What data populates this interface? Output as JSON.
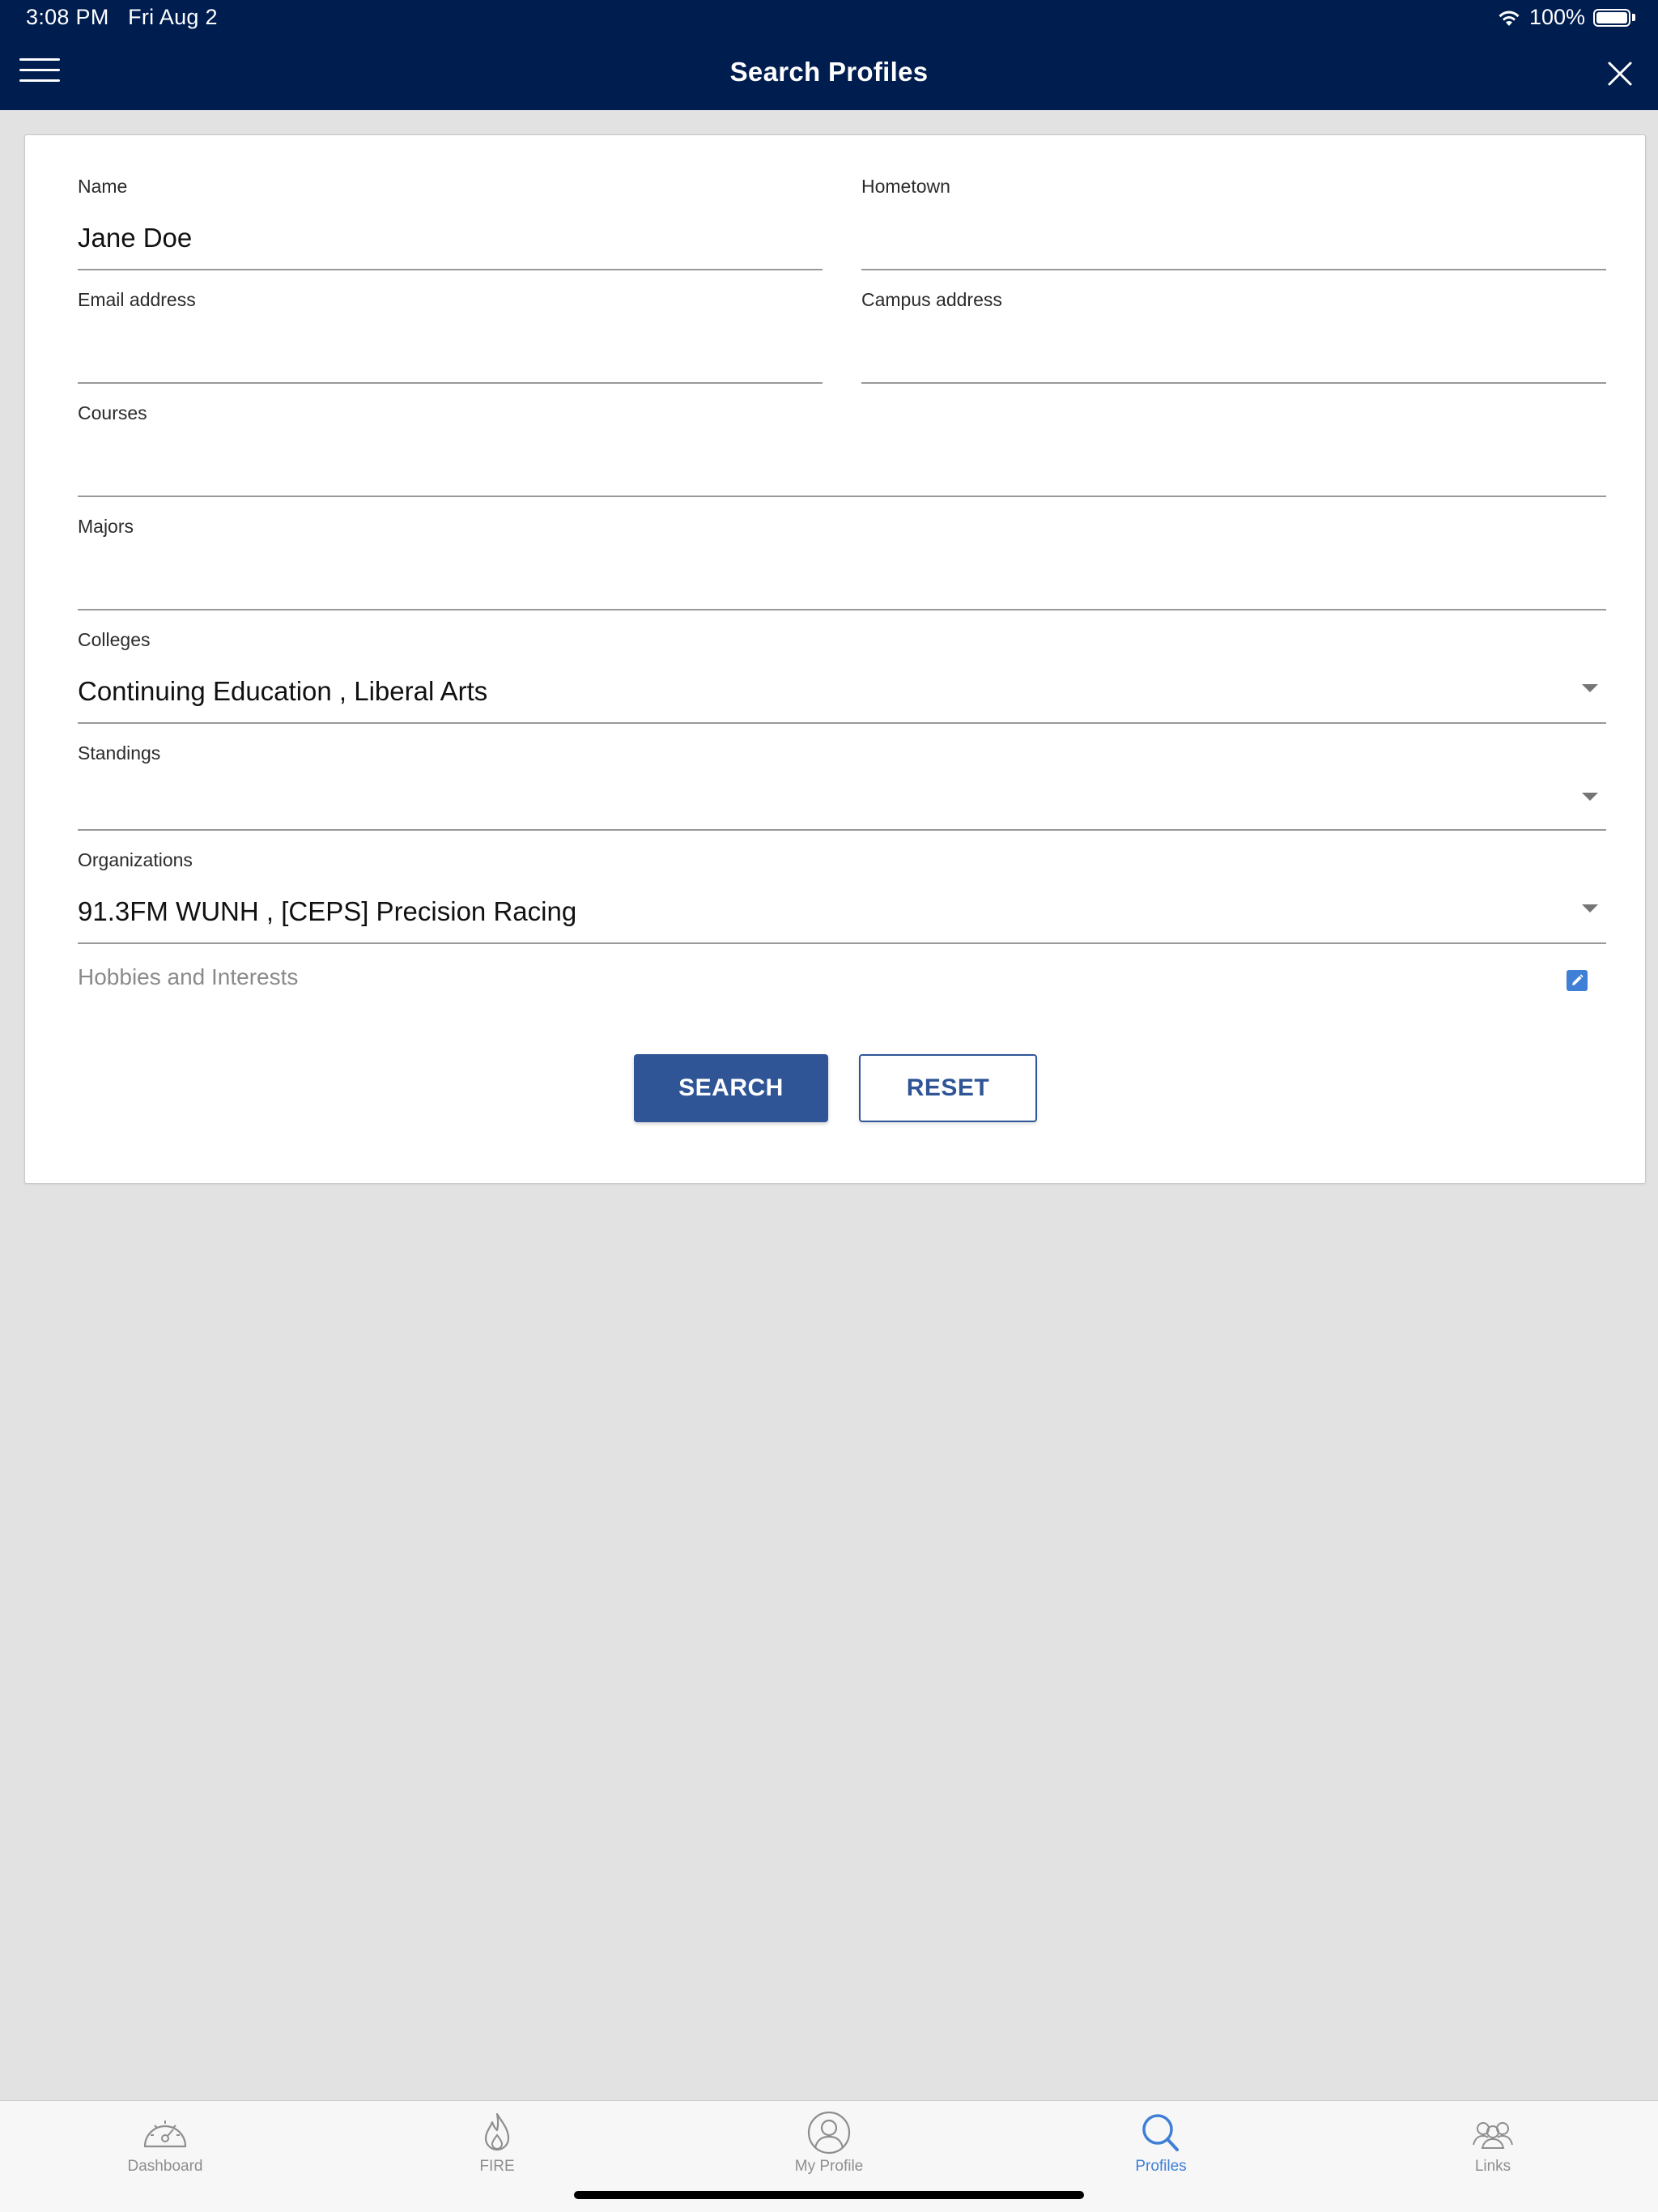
{
  "status_bar": {
    "time": "3:08 PM",
    "date": "Fri Aug 2",
    "battery": "100%"
  },
  "header": {
    "title": "Search Profiles",
    "menu_icon": "hamburger-menu-icon",
    "close_icon": "close-icon"
  },
  "form": {
    "name": {
      "label": "Name",
      "value": "Jane Doe"
    },
    "hometown": {
      "label": "Hometown",
      "value": ""
    },
    "email": {
      "label": "Email address",
      "value": ""
    },
    "campus_address": {
      "label": "Campus address",
      "value": ""
    },
    "courses": {
      "label": "Courses",
      "value": ""
    },
    "majors": {
      "label": "Majors",
      "value": ""
    },
    "colleges": {
      "label": "Colleges",
      "value": "Continuing Education , Liberal Arts"
    },
    "standings": {
      "label": "Standings",
      "value": ""
    },
    "organizations": {
      "label": "Organizations",
      "value": "91.3FM WUNH , [CEPS] Precision Racing"
    },
    "hobbies": {
      "label": "Hobbies and Interests"
    }
  },
  "buttons": {
    "search": "SEARCH",
    "reset": "RESET"
  },
  "tabbar": {
    "items": [
      {
        "label": "Dashboard",
        "icon": "dashboard-gauge-icon",
        "active": false
      },
      {
        "label": "FIRE",
        "icon": "flame-icon",
        "active": false
      },
      {
        "label": "My Profile",
        "icon": "profile-icon",
        "active": false
      },
      {
        "label": "Profiles",
        "icon": "search-icon",
        "active": true
      },
      {
        "label": "Links",
        "icon": "people-group-icon",
        "active": false
      }
    ]
  },
  "colors": {
    "header_bg": "#001d50",
    "primary": "#2f5597",
    "tab_active": "#3f7fd6",
    "page_bg": "#e2e2e2"
  }
}
